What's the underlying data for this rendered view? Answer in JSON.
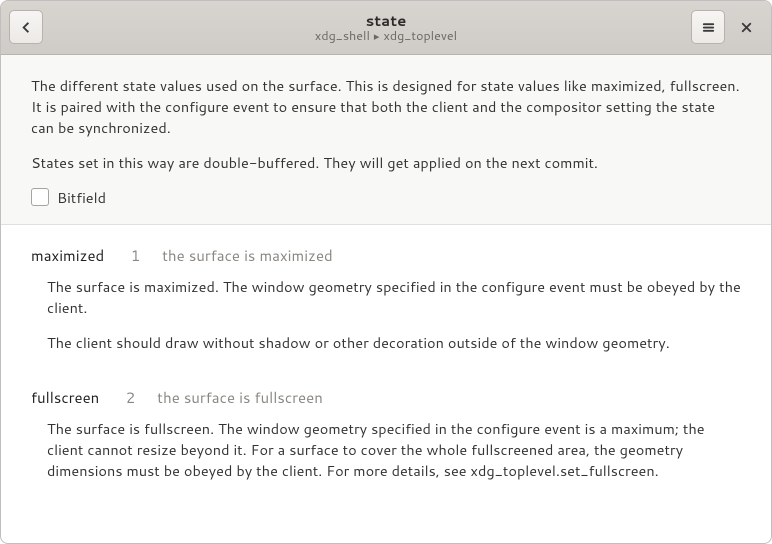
{
  "header": {
    "title": "state",
    "breadcrumb": [
      "xdg_shell",
      "xdg_toplevel"
    ]
  },
  "intro": {
    "p1": "The different state values used on the surface. This is designed for state values like maximized, fullscreen. It is paired with the configure event to ensure that both the client and the compositor setting the state can be synchronized.",
    "p2": "States set in this way are double-buffered. They will get applied on the next commit.",
    "bitfield_label": "Bitfield",
    "bitfield_checked": false
  },
  "enum_entries": [
    {
      "name": "maximized",
      "value": "1",
      "summary": "the surface is maximized",
      "desc": [
        "The surface is maximized. The window geometry specified in the configure   event must be obeyed by the client.",
        "The client should draw without shadow or other   decoration outside of the window geometry."
      ]
    },
    {
      "name": "fullscreen",
      "value": "2",
      "summary": "the surface is fullscreen",
      "desc": [
        "The surface is fullscreen. The window geometry specified in the   configure event is a maximum; the client cannot resize beyond it. For   a surface to cover the whole fullscreened area, the geometry   dimensions must be obeyed by the client. For more details, see   xdg_toplevel.set_fullscreen."
      ]
    }
  ]
}
